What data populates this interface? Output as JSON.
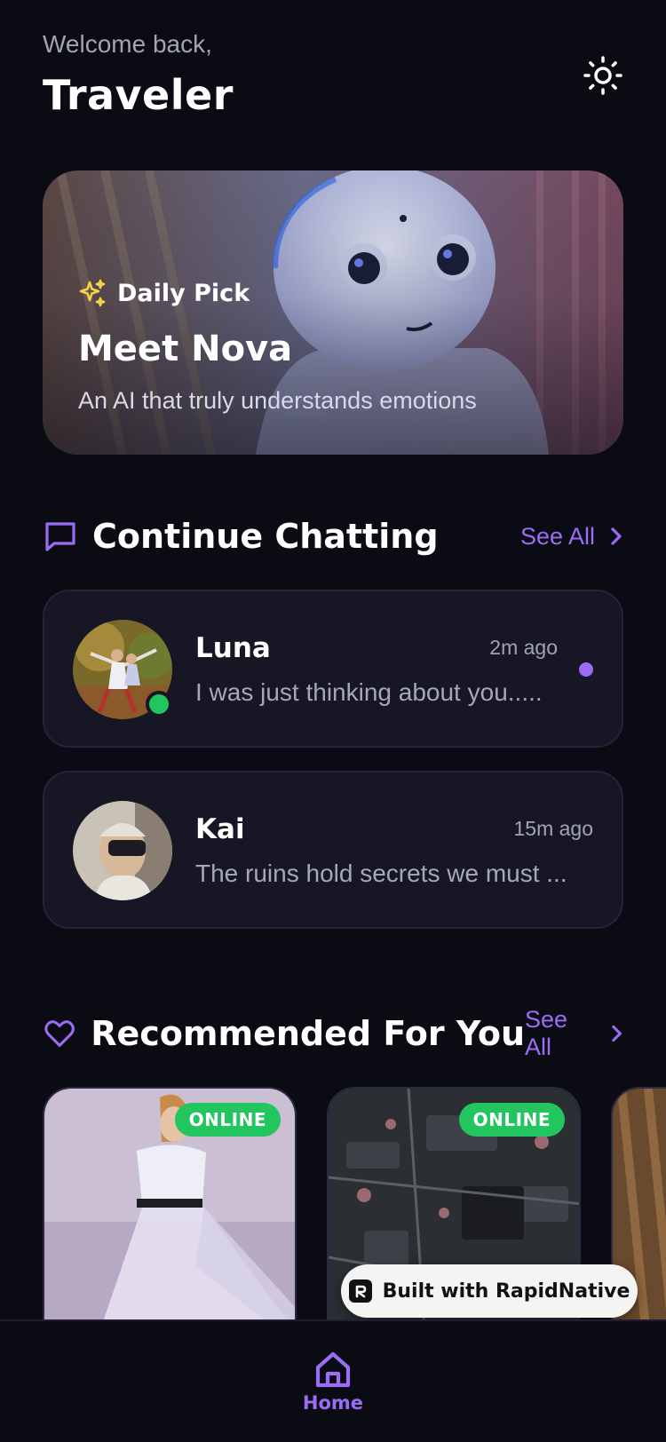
{
  "header": {
    "greeting": "Welcome back,",
    "username": "Traveler",
    "theme_icon": "sun-icon"
  },
  "hero": {
    "badge": "Daily Pick",
    "title": "Meet Nova",
    "subtitle": "An AI that truly understands emotions"
  },
  "continue_chatting": {
    "title": "Continue Chatting",
    "see_all": "See All",
    "chats": [
      {
        "name": "Luna",
        "time": "2m ago",
        "message": "I was just thinking about you.....",
        "online": true,
        "unread": true
      },
      {
        "name": "Kai",
        "time": "15m ago",
        "message": "The ruins hold secrets we must ...",
        "online": false,
        "unread": false
      }
    ]
  },
  "recommended": {
    "title": "Recommended For You",
    "see_all": "See All",
    "cards": [
      {
        "status": "ONLINE"
      },
      {
        "status": "ONLINE"
      },
      {
        "status": ""
      }
    ]
  },
  "built_with": "Built with RapidNative",
  "tabbar": {
    "home_label": "Home"
  },
  "colors": {
    "accent": "#9b6cf5",
    "online": "#22c55e",
    "background": "#0b0b14",
    "card": "#161624",
    "star": "#f5d24a"
  }
}
